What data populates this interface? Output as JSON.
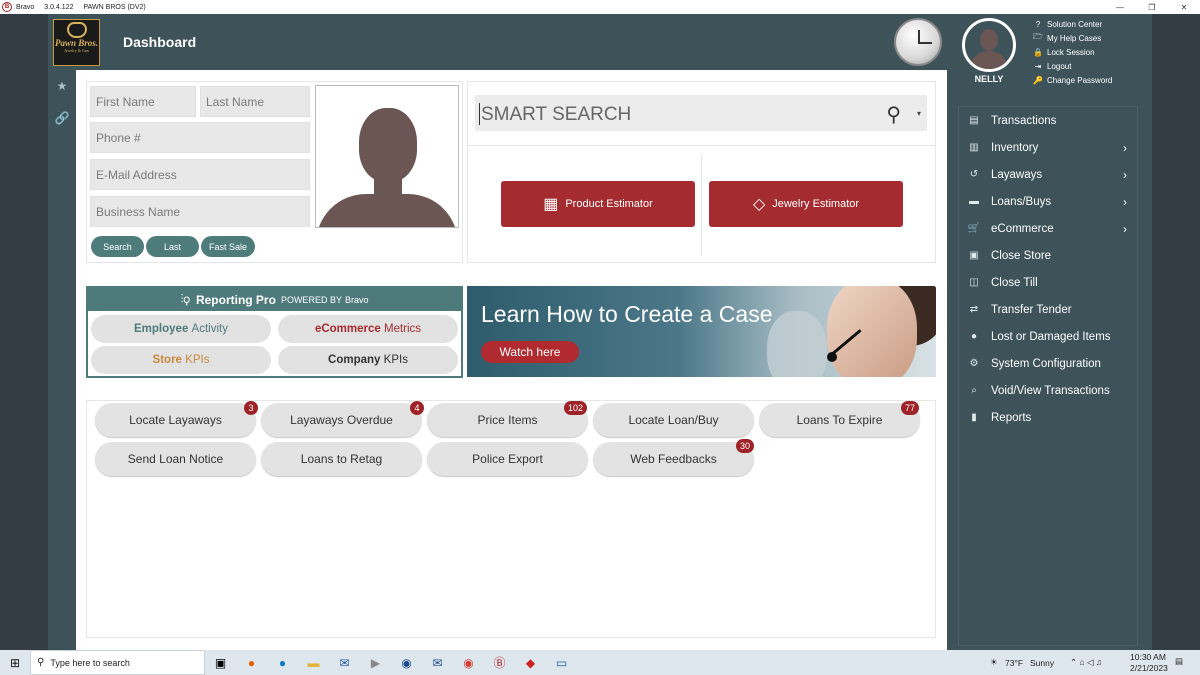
{
  "titlebar": {
    "app": "Bravo",
    "version": "3.0.4.122",
    "store": "PAWN BROS (DV2)",
    "logo_letter": "B",
    "controls": [
      "—",
      "❐",
      "✕"
    ]
  },
  "header": {
    "title": "Dashboard",
    "brand_name": "Pawn Bros.",
    "brand_sub": "Jewelry & Gun"
  },
  "user": {
    "name": "NELLY",
    "menu": [
      {
        "icon": "help-icon",
        "glyph": "?",
        "label": "Solution Center"
      },
      {
        "icon": "folder-icon",
        "glyph": "🗁",
        "label": "My Help Cases"
      },
      {
        "icon": "lock-icon",
        "glyph": "🔒",
        "label": "Lock Session"
      },
      {
        "icon": "logout-icon",
        "glyph": "⇥",
        "label": "Logout"
      },
      {
        "icon": "key-icon",
        "glyph": "🔑",
        "label": "Change Password"
      }
    ]
  },
  "leftrail": [
    {
      "icon": "star-icon",
      "glyph": "★"
    },
    {
      "icon": "link-icon",
      "glyph": "🔗"
    }
  ],
  "customer": {
    "first_name_ph": "First Name",
    "last_name_ph": "Last Name",
    "phone_ph": "Phone #",
    "email_ph": "E-Mail Address",
    "business_ph": "Business Name",
    "buttons": [
      "Search",
      "Last",
      "Fast Sale"
    ]
  },
  "smart_search": {
    "placeholder": "SMART SEARCH",
    "icon": "search-icon",
    "dropdown_icon": "caret-down-icon"
  },
  "estimators": [
    {
      "label": "Product Estimator",
      "icon": "calculator-icon",
      "glyph": "▦"
    },
    {
      "label": "Jewelry Estimator",
      "icon": "diamond-icon",
      "glyph": "◇"
    }
  ],
  "reporting": {
    "title": "Reporting Pro",
    "powered": "POWERED BY",
    "powered_brand": "Bravo",
    "icon": "chart-search-icon",
    "items": [
      {
        "strong": "Employee",
        "rest": "Activity",
        "color": "#4e7a7c"
      },
      {
        "strong": "eCommerce",
        "rest": "Metrics",
        "color": "#a42b2f"
      },
      {
        "strong": "Store",
        "rest": "KPIs",
        "color": "#c9883b"
      },
      {
        "strong": "Company",
        "rest": "KPIs",
        "color": "#333333"
      }
    ]
  },
  "banner": {
    "title": "Learn How to Create a Case",
    "button": "Watch here"
  },
  "quick": [
    {
      "label": "Locate Layaways",
      "badge": "3"
    },
    {
      "label": "Layaways Overdue",
      "badge": "4"
    },
    {
      "label": "Price Items",
      "badge": "102"
    },
    {
      "label": "Locate Loan/Buy",
      "badge": ""
    },
    {
      "label": "Loans To Expire",
      "badge": "77"
    },
    {
      "label": "Send Loan Notice",
      "badge": ""
    },
    {
      "label": "Loans to Retag",
      "badge": ""
    },
    {
      "label": "Police Export",
      "badge": ""
    },
    {
      "label": "Web Feedbacks",
      "badge": "30"
    }
  ],
  "nav": [
    {
      "label": "Transactions",
      "icon": "register-icon",
      "glyph": "▤",
      "chevron": false
    },
    {
      "label": "Inventory",
      "icon": "inventory-icon",
      "glyph": "▥",
      "chevron": true
    },
    {
      "label": "Layaways",
      "icon": "history-icon",
      "glyph": "↺",
      "chevron": true
    },
    {
      "label": "Loans/Buys",
      "icon": "money-icon",
      "glyph": "▬",
      "chevron": true
    },
    {
      "label": "eCommerce",
      "icon": "cart-icon",
      "glyph": "🛒",
      "chevron": true
    },
    {
      "label": "Close Store",
      "icon": "store-icon",
      "glyph": "▣",
      "chevron": false
    },
    {
      "label": "Close Till",
      "icon": "till-icon",
      "glyph": "◫",
      "chevron": false
    },
    {
      "label": "Transfer Tender",
      "icon": "transfer-icon",
      "glyph": "⇄",
      "chevron": false
    },
    {
      "label": "Lost or Damaged Items",
      "icon": "alert-icon",
      "glyph": "●",
      "chevron": false
    },
    {
      "label": "System Configuration",
      "icon": "gears-icon",
      "glyph": "⚙",
      "chevron": false
    },
    {
      "label": "Void/View Transactions",
      "icon": "search-icon",
      "glyph": "⌕",
      "chevron": false
    },
    {
      "label": "Reports",
      "icon": "report-icon",
      "glyph": "▮",
      "chevron": false
    }
  ],
  "taskbar": {
    "search_placeholder": "Type here to search",
    "weather": "73°F",
    "weather_desc": "Sunny",
    "time": "10:30 AM",
    "date": "2/21/2023"
  }
}
